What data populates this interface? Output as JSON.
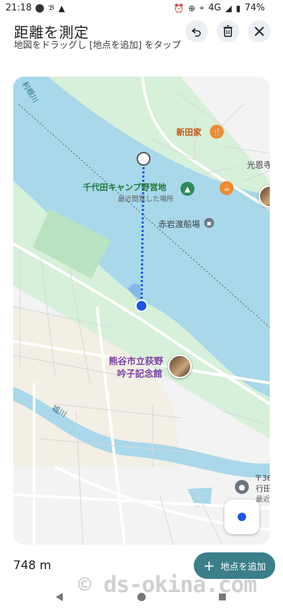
{
  "status_bar": {
    "time": "21:18",
    "indicator": "ℬ",
    "network": "4G",
    "battery": "74%"
  },
  "header": {
    "title": "距離を測定",
    "subtitle": "地図をドラッグし [地点を追加] をタップ",
    "undo_icon": "undo-icon",
    "delete_icon": "trash-icon",
    "close_icon": "close-icon"
  },
  "map": {
    "labels": {
      "river_top": "利根川",
      "river_bottom": "福川",
      "campground": "千代田キャンプ野営地",
      "campground_sub": "最近閲覧した場所",
      "ferry": "赤岩渡船場",
      "restaurant": "新田家",
      "place_right": "光恩寺",
      "memorial_line1": "熊谷市立荻野",
      "memorial_line2": "吟子記念館",
      "postal": "〒36",
      "city": "行田",
      "recent": "最近"
    },
    "colors": {
      "water": "#a8d8ea",
      "park": "#d7f0d9",
      "land": "#f2f2f2",
      "measure_line": "#1a56e8"
    }
  },
  "bottom": {
    "distance": "748 m",
    "add_point_label": "地点を追加",
    "add_icon": "plus-icon"
  },
  "watermark": "© ds-okina.com"
}
